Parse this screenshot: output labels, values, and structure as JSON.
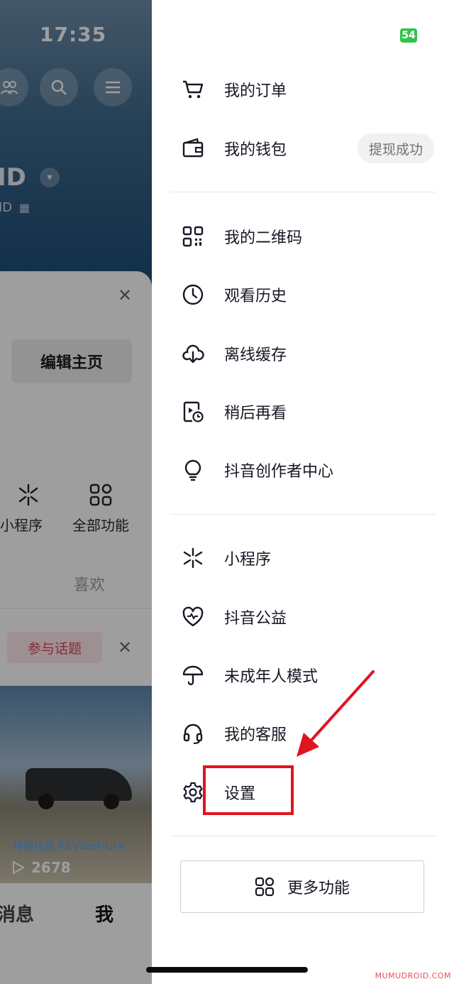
{
  "status": {
    "time": "17:35",
    "battery": "54"
  },
  "background": {
    "id_text": "ID",
    "id_small": "ID",
    "edit_button": "编辑主页",
    "quick": [
      {
        "label": "小程序"
      },
      {
        "label": "全部功能"
      }
    ],
    "likes_tab": "喜欢",
    "topic_button": "参与话题",
    "video": {
      "caption": "特斯拉皮卡Cybertruck",
      "plays": "2678"
    },
    "bottom_tabs": {
      "messages": "消息",
      "me": "我"
    }
  },
  "drawer": {
    "items": [
      {
        "label": "我的订单",
        "icon": "cart-icon"
      },
      {
        "label": "我的钱包",
        "icon": "wallet-icon"
      },
      {
        "label": "我的二维码",
        "icon": "qr-code-icon"
      },
      {
        "label": "观看历史",
        "icon": "clock-icon"
      },
      {
        "label": "离线缓存",
        "icon": "cloud-download-icon"
      },
      {
        "label": "稍后再看",
        "icon": "watch-later-icon"
      },
      {
        "label": "抖音创作者中心",
        "icon": "lightbulb-icon"
      },
      {
        "label": "小程序",
        "icon": "mini-program-icon"
      },
      {
        "label": "抖音公益",
        "icon": "heart-charity-icon"
      },
      {
        "label": "未成年人模式",
        "icon": "umbrella-icon"
      },
      {
        "label": "我的客服",
        "icon": "headset-icon"
      },
      {
        "label": "设置",
        "icon": "gear-icon"
      }
    ],
    "wallet_badge": "提现成功",
    "more_button": "更多功能",
    "annotation_color": "#e0141e"
  },
  "watermark": "MUMUDROID.COM"
}
